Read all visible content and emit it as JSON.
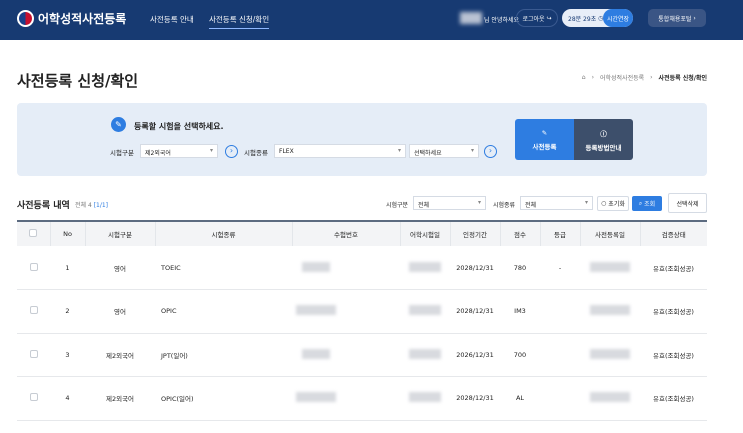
{
  "header": {
    "logo": "어학성적사전등록",
    "nav": [
      "사전등록 안내",
      "사전등록 신청/확인"
    ],
    "greeting": "님 안녕하세요",
    "logout": "로그아웃",
    "timer": "28분 29초",
    "extend": "시간연장",
    "portal": "통합채용포털"
  },
  "page": {
    "title": "사전등록 신청/확인",
    "breadcrumb": [
      "어학성적사전등록",
      "사전등록 신청/확인"
    ]
  },
  "panel": {
    "prompt": "등록할 시험을 선택하세요.",
    "exam_cat_label": "시험구분",
    "exam_cat_value": "제2외국어",
    "exam_type_label": "시험종류",
    "exam_type_value": "FLEX",
    "sub_value": "선택하세요",
    "register": "사전등록",
    "guide": "등록방법안내"
  },
  "list": {
    "title": "사전등록 내역",
    "count": "전체 4",
    "page": "[1/1]",
    "filter_cat_label": "시험구분",
    "filter_cat_value": "전체",
    "filter_type_label": "시험종류",
    "filter_type_value": "전체",
    "reset": "초기화",
    "search": "조회",
    "delete": "선택삭제"
  },
  "table": {
    "headers": [
      "No",
      "시험구분",
      "시험종류",
      "수험번호",
      "어학시험일",
      "인정기간",
      "점수",
      "등급",
      "사전등록일",
      "검증상태"
    ],
    "rows": [
      {
        "no": "1",
        "cat": "영어",
        "type": "TOEIC",
        "period": "2028/12/31",
        "score": "780",
        "grade": "-",
        "status": "유효(조회성공)"
      },
      {
        "no": "2",
        "cat": "영어",
        "type": "OPIC",
        "period": "2028/12/31",
        "score": "IM3",
        "grade": "",
        "status": "유효(조회성공)"
      },
      {
        "no": "3",
        "cat": "제2외국어",
        "type": "JPT(일어)",
        "period": "2026/12/31",
        "score": "700",
        "grade": "",
        "status": "유효(조회성공)"
      },
      {
        "no": "4",
        "cat": "제2외국어",
        "type": "OPIC(일어)",
        "period": "2028/12/31",
        "score": "AL",
        "grade": "",
        "status": "유효(조회성공)"
      }
    ]
  }
}
